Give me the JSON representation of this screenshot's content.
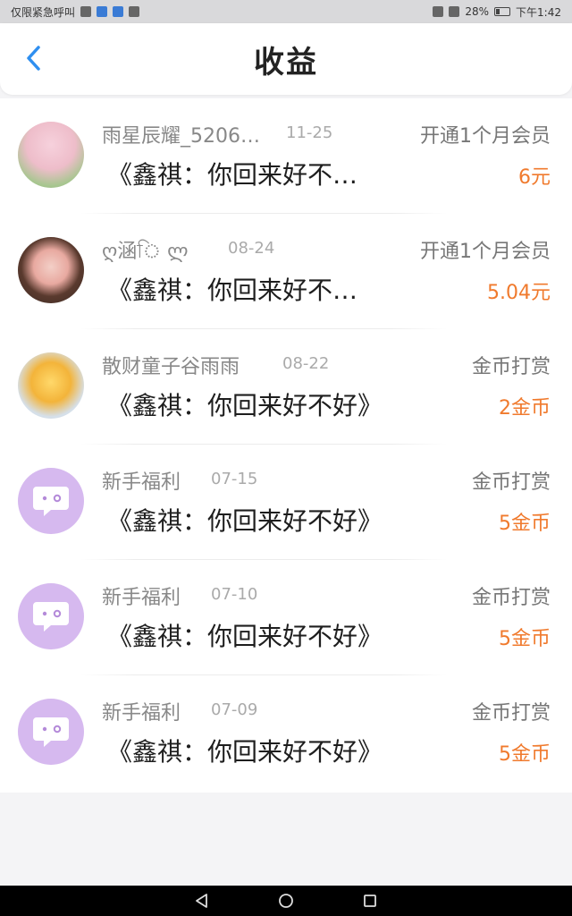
{
  "status_bar": {
    "left_text": "仅限紧急呼叫",
    "battery": "28%",
    "time": "下午1:42"
  },
  "header": {
    "title": "收益"
  },
  "items": [
    {
      "name": "雨星辰耀_5206…",
      "date": "11-25",
      "type": "开通1个月会员",
      "message": "《鑫祺：你回来好不…",
      "amount": "6元",
      "avatar": "sakura-photo"
    },
    {
      "name": "ღ涵ি ლ",
      "date": "08-24",
      "type": "开通1个月会员",
      "message": "《鑫祺：你回来好不…",
      "amount": "5.04元",
      "avatar": "girl-photo"
    },
    {
      "name": "散财童子谷雨雨",
      "date": "08-22",
      "type": "金币打赏",
      "message": "《鑫祺：你回来好不好》",
      "amount": "2金币",
      "avatar": "duck-photo"
    },
    {
      "name": "新手福利",
      "date": "07-15",
      "type": "金币打赏",
      "message": "《鑫祺：你回来好不好》",
      "amount": "5金币",
      "avatar": "chat-bot-icon"
    },
    {
      "name": "新手福利",
      "date": "07-10",
      "type": "金币打赏",
      "message": "《鑫祺：你回来好不好》",
      "amount": "5金币",
      "avatar": "chat-bot-icon"
    },
    {
      "name": "新手福利",
      "date": "07-09",
      "type": "金币打赏",
      "message": "《鑫祺：你回来好不好》",
      "amount": "5金币",
      "avatar": "chat-bot-icon"
    }
  ],
  "colors": {
    "accent_blue": "#2f8ff0",
    "amount_orange": "#f07a2d",
    "avatar_purple": "#d6b9ef"
  }
}
